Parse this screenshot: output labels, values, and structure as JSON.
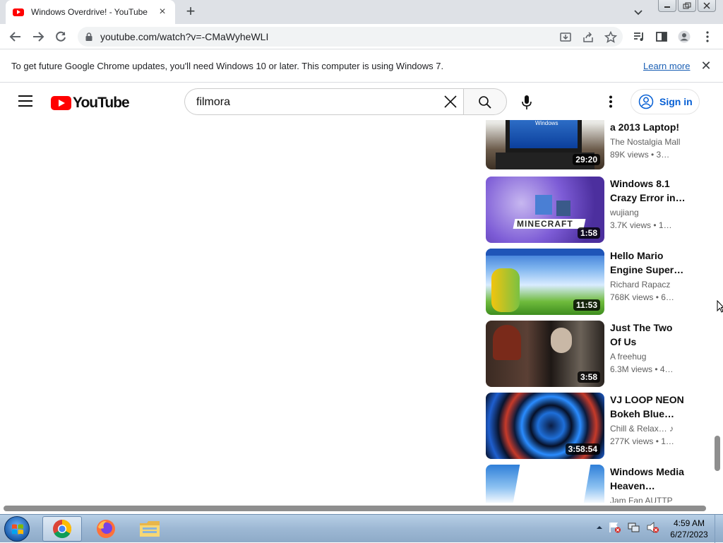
{
  "browser": {
    "tab_title": "Windows Overdrive! - YouTube",
    "url": "youtube.com/watch?v=-CMaWyheWLI"
  },
  "infobar": {
    "message": "To get future Google Chrome updates, you'll need Windows 10 or later. This computer is using Windows 7.",
    "link": "Learn more"
  },
  "youtube": {
    "logo_text": "YouTube",
    "search_query": "filmora",
    "sign_in_label": "Sign in"
  },
  "related_videos": [
    {
      "title_lines": [
        "a 2013 Laptop!"
      ],
      "channel": "The Nostalgia Mall",
      "views": "89K views • 3…",
      "duration": "29:20",
      "thumb_style": "laptop"
    },
    {
      "title_lines": [
        "Windows 8.1",
        "Crazy Error in…"
      ],
      "channel": "wujiang",
      "views": "3.7K views • 1…",
      "duration": "1:58",
      "thumb_style": "minecraft"
    },
    {
      "title_lines": [
        "Hello Mario",
        "Engine Super…"
      ],
      "channel": "Richard Rapacz",
      "views": "768K views • 6…",
      "duration": "11:53",
      "thumb_style": "winxp"
    },
    {
      "title_lines": [
        "Just The Two",
        "Of Us"
      ],
      "channel": "A freehug",
      "views": "6.3M views • 4…",
      "duration": "3:58",
      "thumb_style": "dark"
    },
    {
      "title_lines": [
        "VJ LOOP NEON",
        "Bokeh Blue…"
      ],
      "channel": "Chill & Relax…",
      "channel_icon": "music-note-icon",
      "views": "277K views • 1…",
      "duration": "3:58:54",
      "thumb_style": "neon"
    },
    {
      "title_lines": [
        "Windows Media",
        "Heaven…"
      ],
      "channel": "Jam Fan AUTTP",
      "views": "",
      "duration": "",
      "thumb_style": "sky"
    }
  ],
  "taskbar": {
    "time": "4:59 AM",
    "date": "6/27/2023"
  },
  "colors": {
    "youtube_red": "#ff0000",
    "link_blue": "#065fd4",
    "tabstrip": "#dee1e6"
  }
}
